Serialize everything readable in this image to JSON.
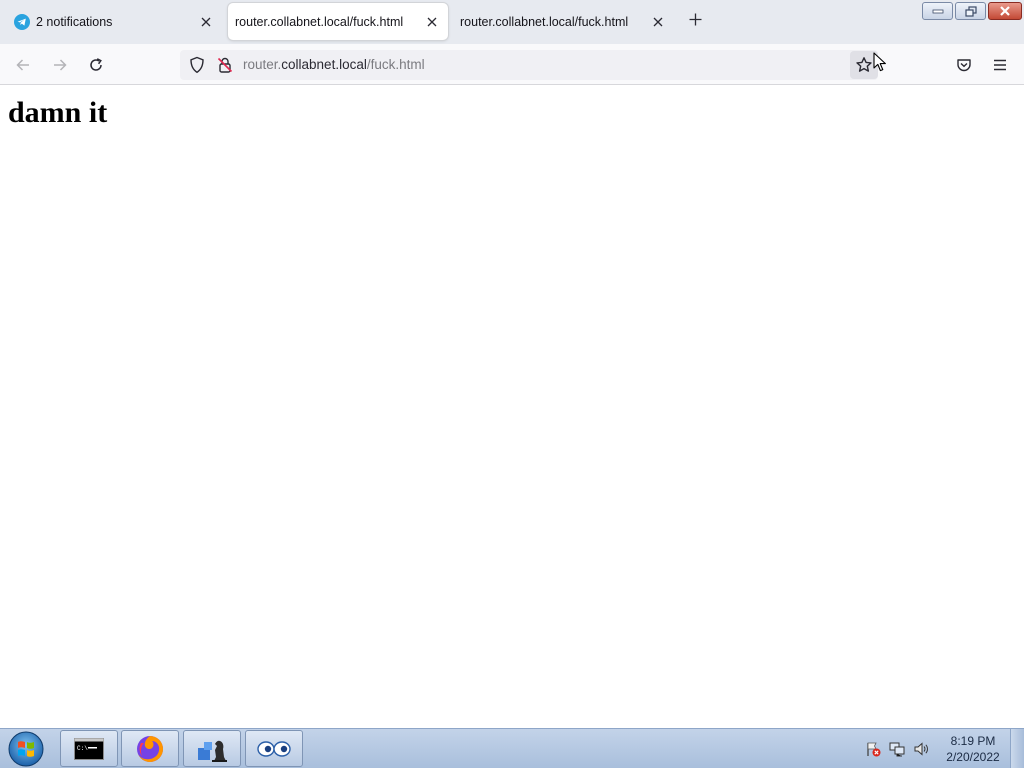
{
  "browser": {
    "tabs": [
      {
        "title": "2 notifications",
        "favicon": "telegram-icon",
        "active": false
      },
      {
        "title": "router.collabnet.local/fuck.html",
        "favicon": "none",
        "active": true
      },
      {
        "title": "router.collabnet.local/fuck.html",
        "favicon": "none",
        "active": false
      }
    ],
    "url": {
      "prefix": "router.",
      "host": "collabnet.local",
      "path": "/fuck.html"
    },
    "icons": {
      "back": "arrow-left-icon",
      "forward": "arrow-right-icon",
      "reload": "reload-icon",
      "tracking": "shield-icon",
      "insecure": "insecure-lock-icon",
      "bookmark": "star-icon",
      "pocket": "pocket-icon",
      "menu": "hamburger-menu-icon",
      "new_tab": "plus-icon"
    }
  },
  "page": {
    "heading": "damn it"
  },
  "taskbar": {
    "apps": [
      "command-prompt",
      "firefox",
      "chess",
      "eyes"
    ],
    "clock": {
      "time": "8:19 PM",
      "date": "2/20/2022"
    }
  },
  "colors": {
    "tabstrip_bg": "#e7eaf0",
    "telegram_blue": "#2aa3df",
    "taskbar_bg": "#b7cae3"
  }
}
